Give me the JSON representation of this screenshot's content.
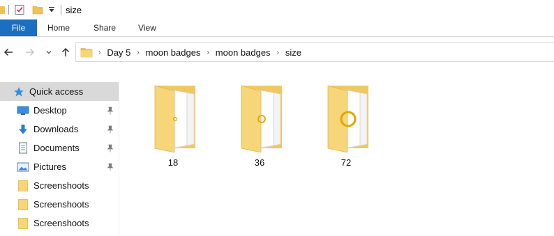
{
  "window": {
    "title": "size"
  },
  "ribbon": {
    "tabs": [
      {
        "label": "File"
      },
      {
        "label": "Home"
      },
      {
        "label": "Share"
      },
      {
        "label": "View"
      }
    ]
  },
  "navigation": {
    "breadcrumb": [
      "Day 5",
      "moon badges",
      "moon badges",
      "size"
    ]
  },
  "sidebar": {
    "items": [
      {
        "label": "Quick access",
        "icon": "star-icon",
        "selected": true
      },
      {
        "label": "Desktop",
        "icon": "desktop-icon",
        "pinned": true
      },
      {
        "label": "Downloads",
        "icon": "download-icon",
        "pinned": true
      },
      {
        "label": "Documents",
        "icon": "document-icon",
        "pinned": true
      },
      {
        "label": "Pictures",
        "icon": "pictures-icon",
        "pinned": true
      },
      {
        "label": "Screenshoots",
        "icon": "folder-icon"
      },
      {
        "label": "Screenshoots",
        "icon": "folder-icon"
      },
      {
        "label": "Screenshoots",
        "icon": "folder-icon"
      }
    ]
  },
  "content": {
    "folders": [
      {
        "name": "18",
        "badge_scale": 0.25
      },
      {
        "name": "36",
        "badge_scale": 0.5
      },
      {
        "name": "72",
        "badge_scale": 1.0
      }
    ]
  },
  "colors": {
    "file_tab": "#1a6fc2",
    "folder_yellow": "#f7d67a",
    "folder_dark": "#e3b54a",
    "selected_bg": "#d9d9d9",
    "badge_gold": "#e0a800"
  }
}
